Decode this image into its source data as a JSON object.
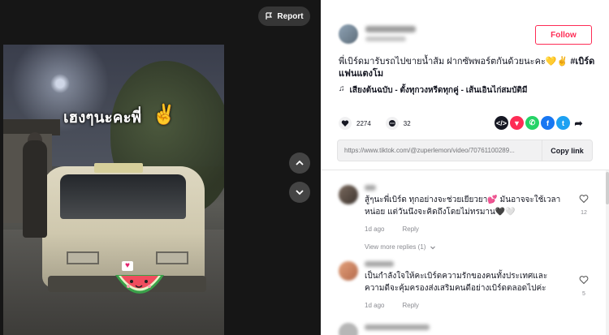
{
  "video": {
    "overlay_text": "เฮงๆนะคะพี่",
    "overlay_emoji": "✌",
    "report_label": "Report",
    "sticker_icon": "watermelon-sticker"
  },
  "post": {
    "follow_label": "Follow",
    "caption": "พี่เบิร์ดมารับรถไปขายน้ำส้ม ฝากซัพพอร์ตกันด้วยนะคะ💛✌",
    "hashtag": "#เบิร์ดแฟนแตงโม",
    "music_icon": "♫",
    "music": "เสียงต้นฉบับ - ตั้งทุกวงหรีดทุกคู่ - เส้นเอินไก่สมบัติมี",
    "likes": "2274",
    "comments": "32",
    "url": "https://www.tiktok.com/@zuperlemon/video/70761100289...",
    "copy_label": "Copy link",
    "share_colors": {
      "embed": "#161823",
      "tiktok": "#fe2c55",
      "whatsapp": "#25d366",
      "facebook": "#1877f2",
      "twitter": "#1da1f2"
    }
  },
  "comments": [
    {
      "text": "สู้ๆนะพี่เบิร์ด ทุกอย่างจะช่วยเยียวยา💕 มันอาจจะใช้เวลาหน่อย แต่วันนึงจะคิดถึงโดยไม่ทรมาน🖤🤍",
      "time": "1d ago",
      "reply_label": "Reply",
      "likes": "12"
    },
    {
      "text": "เป็นกำลังใจให้คะเบิร์ดความรักของคนทั้งประเทศและความดีจะคุ้มครองส่งเสริมคนดีอย่างเบิร์ดตลอดไปค่ะ",
      "time": "1d ago",
      "reply_label": "Reply",
      "likes": "5"
    }
  ],
  "view_more_replies": "View more replies (1)"
}
